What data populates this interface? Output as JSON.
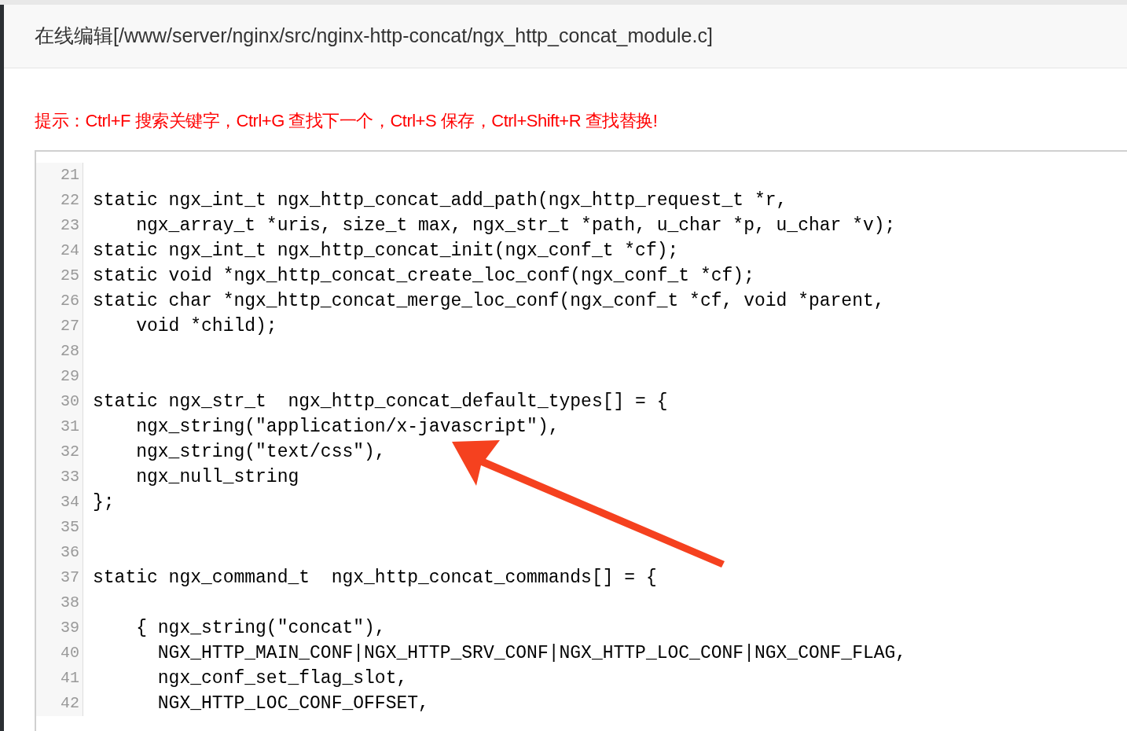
{
  "dialog": {
    "title": "在线编辑[/www/server/nginx/src/nginx-http-concat/ngx_http_concat_module.c]"
  },
  "hint": "提示：Ctrl+F 搜索关键字，Ctrl+G 查找下一个，Ctrl+S 保存，Ctrl+Shift+R 查找替换!",
  "editor": {
    "lines": [
      {
        "number": "21"
      },
      {
        "number": "22",
        "code": "static ngx_int_t ngx_http_concat_add_path(ngx_http_request_t *r,"
      },
      {
        "number": "23",
        "code": "    ngx_array_t *uris, size_t max, ngx_str_t *path, u_char *p, u_char *v);"
      },
      {
        "number": "24",
        "code": "static ngx_int_t ngx_http_concat_init(ngx_conf_t *cf);"
      },
      {
        "number": "25",
        "code": "static void *ngx_http_concat_create_loc_conf(ngx_conf_t *cf);"
      },
      {
        "number": "26",
        "code": "static char *ngx_http_concat_merge_loc_conf(ngx_conf_t *cf, void *parent,"
      },
      {
        "number": "27",
        "code": "    void *child);"
      },
      {
        "number": "28"
      },
      {
        "number": "29"
      },
      {
        "number": "30",
        "code": "static ngx_str_t  ngx_http_concat_default_types[] = {"
      },
      {
        "number": "31",
        "code": "    ngx_string(\"application/x-javascript\"),"
      },
      {
        "number": "32",
        "code": "    ngx_string(\"text/css\"),"
      },
      {
        "number": "33",
        "code": "    ngx_null_string"
      },
      {
        "number": "34",
        "code": "};"
      },
      {
        "number": "35"
      },
      {
        "number": "36"
      },
      {
        "number": "37",
        "code": "static ngx_command_t  ngx_http_concat_commands[] = {"
      },
      {
        "number": "38"
      },
      {
        "number": "39",
        "code": "    { ngx_string(\"concat\"),"
      },
      {
        "number": "40",
        "code": "      NGX_HTTP_MAIN_CONF|NGX_HTTP_SRV_CONF|NGX_HTTP_LOC_CONF|NGX_CONF_FLAG,"
      },
      {
        "number": "41",
        "code": "      ngx_conf_set_flag_slot,"
      },
      {
        "number": "42",
        "code": "      NGX_HTTP_LOC_CONF_OFFSET,"
      }
    ]
  }
}
